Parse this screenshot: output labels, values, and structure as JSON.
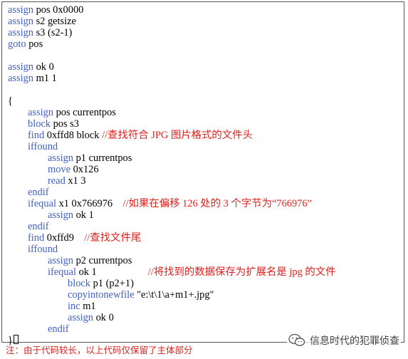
{
  "colors": {
    "keyword": "#4060c8",
    "comment": "#e0201c",
    "text": "#000000",
    "border": "#555555"
  },
  "code": {
    "l1": {
      "kw": "assign",
      "rest": " pos 0x0000"
    },
    "l2": {
      "kw": "assign",
      "rest": " s2 getsize"
    },
    "l3": {
      "kw": "assign",
      "rest": " s3 (s2-1)"
    },
    "l4": {
      "kw": "goto",
      "rest": " pos"
    },
    "l6": {
      "kw": "assign",
      "rest": " ok 0"
    },
    "l7": {
      "kw": "assign",
      "rest": " m1 1"
    },
    "l9": {
      "text": "{"
    },
    "l10": {
      "kw": "assign",
      "rest": " pos currentpos"
    },
    "l11": {
      "kw": "block",
      "rest": " pos s3"
    },
    "l12": {
      "kw": "find",
      "rest": " 0xffd8 block ",
      "comment": "//查找符合 JPG 图片格式的文件头"
    },
    "l13": {
      "kw": "iffound"
    },
    "l14": {
      "kw": "assign",
      "rest": " p1 currentpos"
    },
    "l15": {
      "kw": "move",
      "rest": " 0x126"
    },
    "l16": {
      "kw": "read",
      "rest": " x1 3"
    },
    "l17": {
      "kw": "endif"
    },
    "l18": {
      "kw": "ifequal",
      "rest": " x1 0x766976    ",
      "comment": "//如果在偏移 126 处的 3 个字节为“766976”"
    },
    "l19": {
      "kw": "assign",
      "rest": " ok 1"
    },
    "l20": {
      "kw": "endif"
    },
    "l21": {
      "kw": "find",
      "rest": " 0xffd9    ",
      "comment": "//查找文件尾"
    },
    "l22": {
      "kw": "iffound"
    },
    "l23": {
      "kw": "assign",
      "rest": " p2 currentpos"
    },
    "l24": {
      "kw": "ifequal",
      "rest": " ok 1                    ",
      "comment": "//将找到的数据保存为扩展名是 jpg 的文件"
    },
    "l25": {
      "kw": "block",
      "rest": " p1 (p2+1)"
    },
    "l26": {
      "kw": "copyintonewfile",
      "rest": " \"e:\\t\\1\\a+m1+.jpg\""
    },
    "l27": {
      "kw": "inc",
      "rest": " m1"
    },
    "l28": {
      "kw": "assign",
      "rest": " ok 0"
    },
    "l29": {
      "kw": "endif"
    },
    "l30": {
      "text": "}"
    }
  },
  "note": "注：由于代码较长，以上代码仅保留了主体部分",
  "watermark": {
    "icon": "wechat-icon",
    "text": "信息时代的犯罪侦查"
  }
}
